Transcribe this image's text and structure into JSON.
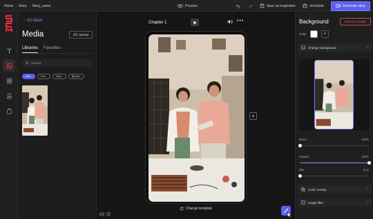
{
  "topbar": {
    "breadcrumbs": [
      "Home",
      "Story",
      "Story_name"
    ],
    "preview_label": "Preview",
    "save_inspiration_label": "Save as inspiration",
    "schedule_label": "Schedule",
    "generate_label": "Generate story"
  },
  "brand": {
    "logo_text": "SCM"
  },
  "left_rail": {
    "icons": [
      "text-icon",
      "media-icon",
      "elements-icon",
      "uploads-icon",
      "brand-icon"
    ],
    "active": "media-icon"
  },
  "media_panel": {
    "go_back": "Go back",
    "title": "Media",
    "upload_label": "Upload",
    "tabs": [
      {
        "label": "Libraries",
        "active": true
      },
      {
        "label": "Favorites",
        "active": false
      }
    ],
    "search_placeholder": "Search",
    "chips": [
      {
        "label": "Stor..",
        "active": true
      },
      {
        "label": "Uns..",
        "active": false
      },
      {
        "label": "Giph..",
        "active": false
      },
      {
        "label": "Inst..",
        "active": false
      }
    ]
  },
  "canvas": {
    "chapter_label": "Chapter 1",
    "change_template_label": "Change template"
  },
  "right_panel": {
    "title": "Background",
    "remove_media_label": "Remove media",
    "color_label": "Color",
    "selected_color": "#ffffff",
    "change_background_label": "Change background",
    "sliders": [
      {
        "label": "Zoom",
        "value_text": "100%",
        "fraction": 0.0
      },
      {
        "label": "Opacity",
        "value_text": "100%",
        "fraction": 1.0
      },
      {
        "label": "Blur",
        "value_text": "0 px",
        "fraction": 0.0
      }
    ],
    "color_overlay_label": "Color overlay",
    "image_filter_label": "Image filter"
  },
  "colors": {
    "accent": "#5b5ef0",
    "brand_red": "#e0323c",
    "danger": "#d04a4a"
  }
}
